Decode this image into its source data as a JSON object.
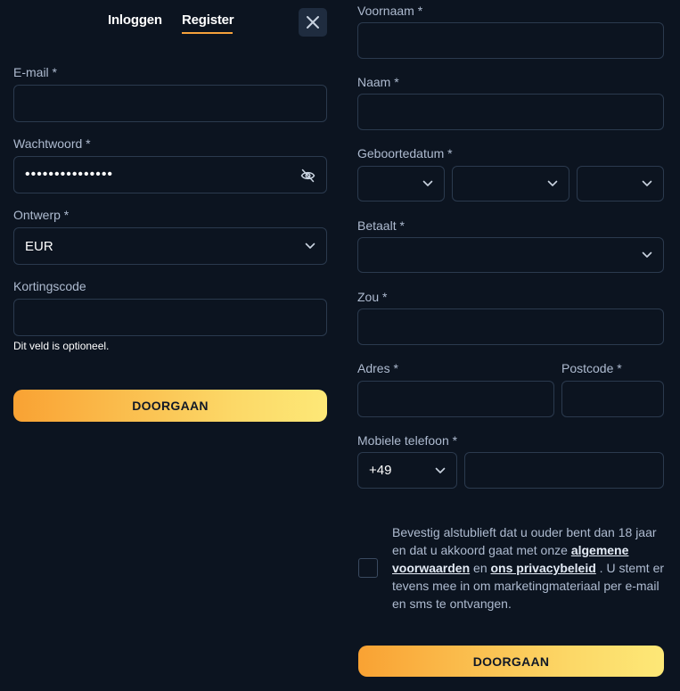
{
  "tabs": [
    {
      "label": "Inloggen",
      "active": false
    },
    {
      "label": "Register",
      "active": true
    }
  ],
  "accent_color": "#f7a23b",
  "left": {
    "email_label": "E-mail *",
    "email_value": "",
    "password_label": "Wachtwoord *",
    "password_value": "•••••••••••••••",
    "currency_label": "Ontwerp *",
    "currency_value": "EUR",
    "promo_label": "Kortingscode",
    "promo_value": "",
    "promo_hint": "Dit veld is optioneel.",
    "submit_label": "DOORGAAN"
  },
  "right": {
    "firstname_label": "Voornaam *",
    "lastname_label": "Naam *",
    "birthdate_label": "Geboortedatum *",
    "country_label": "Betaalt *",
    "city_label": "Zou *",
    "address_label": "Adres *",
    "postcode_label": "Postcode *",
    "phone_label": "Mobiele telefoon *",
    "phone_prefix": "+49",
    "consent": {
      "text_1": "Bevestig alstublieft dat u ouder bent dan 18 jaar en dat u akkoord gaat met onze",
      "terms_link": "algemene voorwaarden",
      "text_2": "en",
      "privacy_link": "ons privacybeleid",
      "text_3": ". U stemt er tevens mee in om marketingmateriaal per e-mail en sms te ontvangen."
    },
    "submit_label": "DOORGAAN"
  },
  "icons": {
    "close": "close-icon",
    "eye": "eye-off-icon",
    "chevron": "chevron-down-icon"
  }
}
